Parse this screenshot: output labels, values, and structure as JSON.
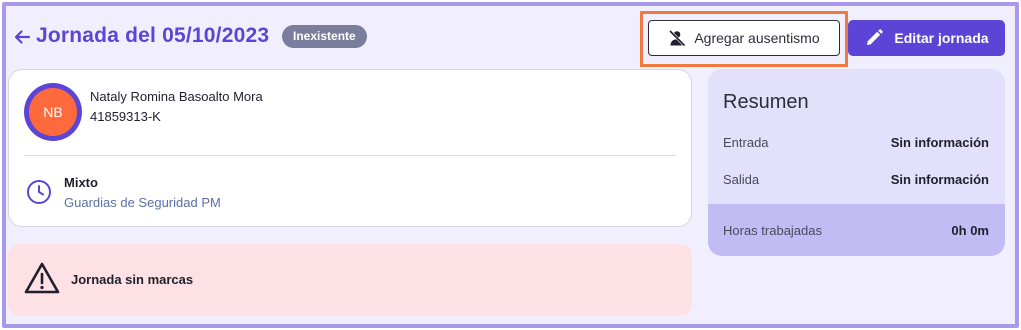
{
  "header": {
    "title": "Jornada del 05/10/2023",
    "status_badge": "Inexistente",
    "absence_button_label": "Agregar ausentismo",
    "edit_button_label": "Editar jornada"
  },
  "employee": {
    "initials": "NB",
    "name": "Nataly Romina Basoalto Mora",
    "id": "41859313-K",
    "shift_type": "Mixto",
    "shift_group": "Guardias de Seguridad PM"
  },
  "alert": {
    "message": "Jornada sin marcas"
  },
  "summary": {
    "title": "Resumen",
    "rows": [
      {
        "label": "Entrada",
        "value": "Sin información"
      },
      {
        "label": "Salida",
        "value": "Sin información"
      }
    ],
    "hours": {
      "label": "Horas trabajadas",
      "value": "0h 0m"
    }
  },
  "colors": {
    "accent": "#5c45d6",
    "avatar": "#ff6a3d",
    "badge": "#7a7d9c",
    "alert_bg": "#fde1e4",
    "summary_bg": "#e2e0fb",
    "highlight": "#f07a3e"
  },
  "icons": {
    "back": "arrow-left-icon",
    "absence": "user-off-icon",
    "edit": "pencil-icon",
    "shift": "clock-icon",
    "alert": "warning-icon"
  }
}
